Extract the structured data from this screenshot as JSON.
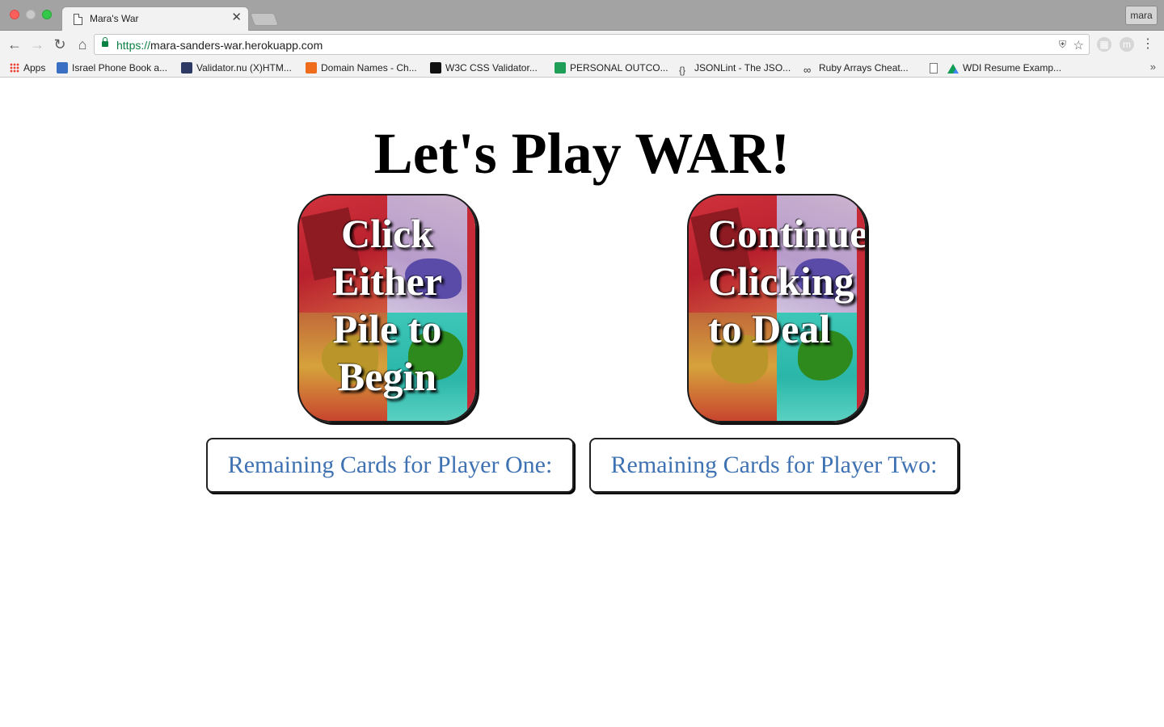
{
  "browser": {
    "tab_title": "Mara's War",
    "tab_close": "✕",
    "profile": "mara",
    "url_scheme": "https://",
    "url_host": "mara-sanders-war.herokuapp.com",
    "bookmarks": [
      {
        "label": "Apps",
        "icon": "apps-icon"
      },
      {
        "label": "Israel Phone Book a...",
        "icon": "flag-icon",
        "color": "#3b6fc4"
      },
      {
        "label": "Validator.nu (X)HTM...",
        "icon": "validator-icon",
        "color": "#2e3a63"
      },
      {
        "label": "Domain Names - Ch...",
        "icon": "chart-icon",
        "color": "#ef6c1c"
      },
      {
        "label": "W3C CSS Validator...",
        "icon": "w3c-icon",
        "color": "#111111"
      },
      {
        "label": "PERSONAL OUTCO...",
        "icon": "sheets-icon",
        "color": "#1e9e56"
      },
      {
        "label": "JSONLint - The JSO...",
        "icon": "braces-icon",
        "color": "#444444"
      },
      {
        "label": "Ruby Arrays Cheat...",
        "icon": "infinity-icon",
        "color": "#333333"
      },
      {
        "label": "",
        "icon": "page-icon",
        "color": "#ffffff"
      },
      {
        "label": "WDI Resume Examp...",
        "icon": "drive-icon",
        "color": "#f4b400"
      }
    ],
    "bookmarks_more": "»"
  },
  "page": {
    "heading": "Let's Play WAR!",
    "card_one_text": "Click\nEither\nPile to\nBegin",
    "card_two_text": "Continue\nClicking\nto Deal",
    "player_one_label": "Remaining Cards for Player One:",
    "player_two_label": "Remaining Cards for Player Two:"
  },
  "colors": {
    "count_text": "#3f72b2",
    "secure_green": "#0b8043"
  }
}
